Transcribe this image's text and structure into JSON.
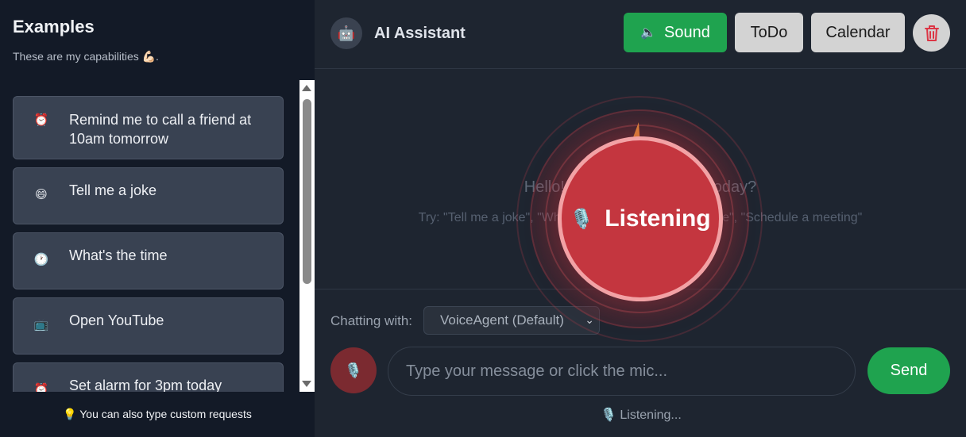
{
  "sidebar": {
    "title": "Examples",
    "subtitle": "These are my capabilities 💪🏻.",
    "items": [
      {
        "icon": "⏰",
        "icon_name": "alarm-clock-icon",
        "label": "Remind me to call a friend at 10am tomorrow"
      },
      {
        "icon": "😄",
        "icon_name": "laughing-face-icon",
        "label": "Tell me a joke"
      },
      {
        "icon": "🕐",
        "icon_name": "clock-icon",
        "label": "What's the time"
      },
      {
        "icon": "📺",
        "icon_name": "television-icon",
        "label": "Open YouTube"
      },
      {
        "icon": "⏰",
        "icon_name": "alarm-clock-icon",
        "label": "Set alarm for 3pm today"
      }
    ],
    "tip": "💡 You can also type custom requests"
  },
  "header": {
    "avatar_icon": "🤖",
    "title": "AI Assistant",
    "sound_icon": "🔈",
    "sound_label": "Sound",
    "todo_label": "ToDo",
    "calendar_label": "Calendar",
    "trash_icon": "trash-icon"
  },
  "chat": {
    "hello": "Hello! How can I help you today?",
    "try": "Try: \"Tell me a joke\", \"What's the time\", \"Open YouTube\", \"Schedule a meeting\""
  },
  "overlay": {
    "mic_icon": "🎙️",
    "label": "Listening"
  },
  "footer": {
    "chatting_with_label": "Chatting with:",
    "agent_selected": "VoiceAgent (Default)",
    "mic_icon": "🎙️",
    "input_placeholder": "Type your message or click the mic...",
    "send_label": "Send",
    "status_icon": "🎙️",
    "status_text": "Listening..."
  },
  "colors": {
    "sidebar_bg": "#131a27",
    "main_bg": "#1e2530",
    "card_bg": "#394252",
    "accent_green": "#1fa34f",
    "listen_red": "#c4363f",
    "button_gray": "#d3d3d3"
  }
}
